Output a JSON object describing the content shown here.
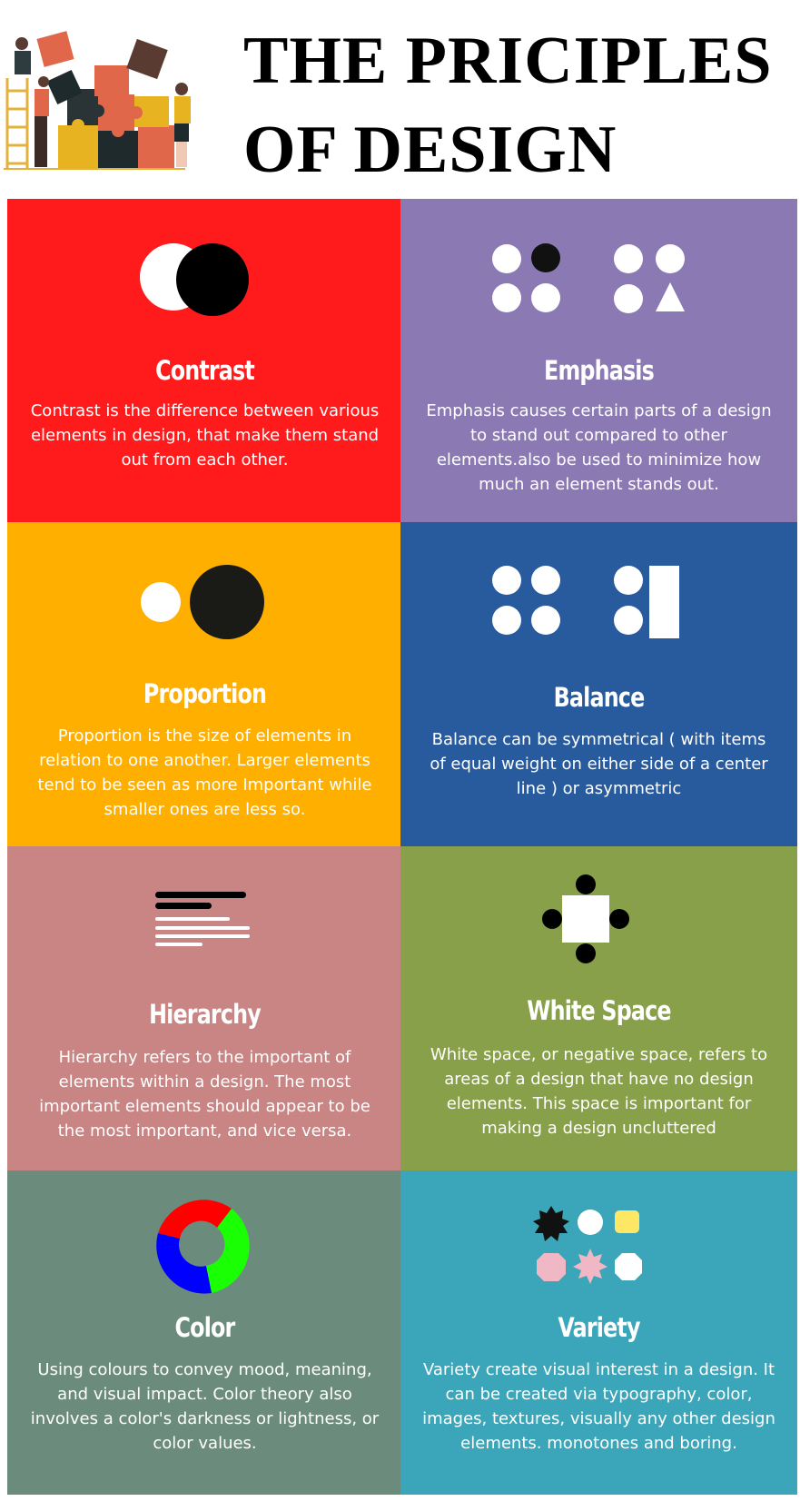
{
  "title_line1": "THE PRICIPLES",
  "title_line2": "OF DESIGN",
  "principles": [
    {
      "heading": "Contrast",
      "text": "Contrast is the difference between various elements in design, that make them stand out from each other.",
      "bg": "#ff1b1c",
      "icon": "contrast-circles-icon"
    },
    {
      "heading": "Emphasis",
      "text": "Emphasis causes certain parts of a design to stand out compared to other elements.also be used to minimize how much an element stands out.",
      "bg": "#8b79b4",
      "icon": "emphasis-dots-icon"
    },
    {
      "heading": "Proportion",
      "text": "Proportion is the size of elements in relation to one another. Larger elements tend to be seen as more Important while smaller ones are less so.",
      "bg": "#ffaf00",
      "icon": "proportion-circles-icon"
    },
    {
      "heading": "Balance",
      "text": "Balance can be symmetrical ( with items of equal weight on either side of a center line ) or asymmetric",
      "bg": "#275b9e",
      "icon": "balance-shapes-icon"
    },
    {
      "heading": "Hierarchy",
      "text": "Hierarchy refers to the important of elements within a design. The most important elements should appear to be the most important, and vice versa.",
      "bg": "#c98484",
      "icon": "hierarchy-lines-icon"
    },
    {
      "heading": "White Space",
      "text": "White space, or negative space, refers to areas of a design that have no design elements. This space is important for making a design uncluttered",
      "bg": "#88a049",
      "icon": "white-space-square-icon"
    },
    {
      "heading": "Color",
      "text": "Using colours to convey mood, meaning, and visual impact. Color theory also involves a color's darkness or lightness, or color values.",
      "bg": "#6b8c7c",
      "icon": "color-wheel-icon"
    },
    {
      "heading": "Variety",
      "text": "Variety create visual interest in a design. It can be created via typography, color, images, textures, visually any other design elements. monotones and boring.",
      "bg": "#3ba6b9",
      "icon": "variety-shapes-icon"
    }
  ]
}
